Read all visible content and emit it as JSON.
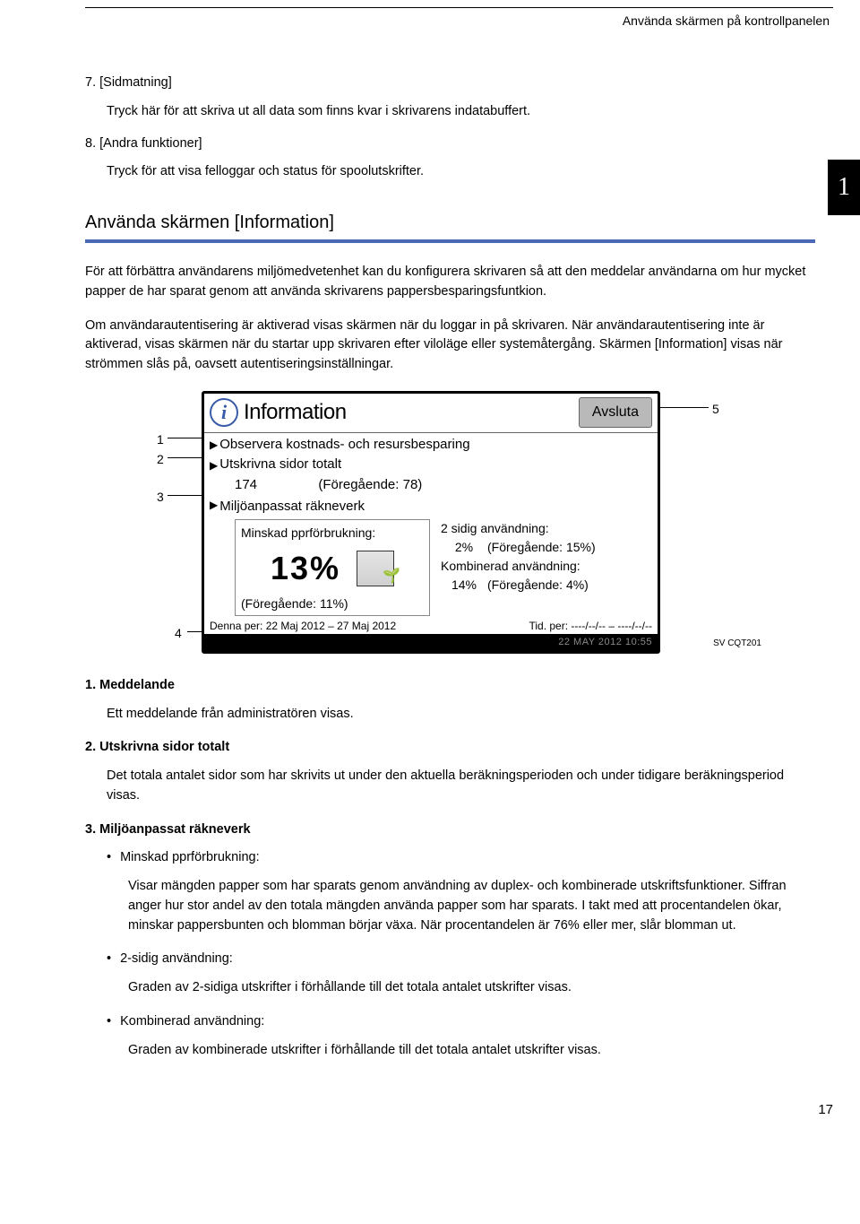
{
  "header": {
    "title": "Använda skärmen på kontrollpanelen"
  },
  "chapter_tab": "1",
  "ol7": {
    "num": "7.",
    "title": "[Sidmatning]",
    "body": "Tryck här för att skriva ut all data som finns kvar i skrivarens indatabuffert."
  },
  "ol8": {
    "num": "8.",
    "title": "[Andra funktioner]",
    "body": "Tryck för att visa felloggar och status för spoolutskrifter."
  },
  "section": {
    "title": "Använda skärmen [Information]",
    "p1": "För att förbättra användarens miljömedvetenhet kan du konfigurera skrivaren så att den meddelar användarna om hur mycket papper de har sparat genom att använda skrivarens pappersbesparingsfuntkion.",
    "p2": "Om användarautentisering är aktiverad visas skärmen när du loggar in på skrivaren. När användarautentisering inte är aktiverad, visas skärmen när du startar upp skrivaren efter viloläge eller systemåtergång. Skärmen [Information] visas när strömmen slås på, oavsett autentiseringsinställningar."
  },
  "callouts": {
    "c1": "1",
    "c2": "2",
    "c3": "3",
    "c4": "4",
    "c5": "5"
  },
  "panel": {
    "title": "Information",
    "exit": "Avsluta",
    "msg": "Observera kostnads- och resursbesparing",
    "total_label": "Utskrivna sidor totalt",
    "total_val": "174",
    "total_prev": "(Föregående: 78)",
    "eco_label": "Miljöanpassat räkneverk",
    "eco_reduce_label": "Minskad pprförbrukning:",
    "eco_reduce_val": "13%",
    "eco_reduce_prev": "(Föregående: 11%)",
    "duplex_label": "2 sidig användning:",
    "duplex_val": "2%",
    "duplex_prev": "(Föregående: 15%)",
    "combine_label": "Kombinerad användning:",
    "combine_val": "14%",
    "combine_prev": "(Föregående: 4%)",
    "period_now": "Denna per: 22 Maj 2012 – 27 Maj 2012",
    "period_prev": "Tid. per:    ----/--/-- – ----/--/--",
    "status": "22 MAY 2012 10:55"
  },
  "img_id": "SV CQT201",
  "defs": {
    "d1": {
      "num": "1.",
      "title": "Meddelande",
      "body": "Ett meddelande från administratören visas."
    },
    "d2": {
      "num": "2.",
      "title": "Utskrivna sidor totalt",
      "body": "Det totala antalet sidor som har skrivits ut under den aktuella beräkningsperioden och under tidigare beräkningsperiod visas."
    },
    "d3": {
      "num": "3.",
      "title": "Miljöanpassat räkneverk"
    },
    "b1": {
      "label": "Minskad pprförbrukning:",
      "body": "Visar mängden papper som har sparats genom användning av duplex- och kombinerade utskriftsfunktioner. Siffran anger hur stor andel av den totala mängden använda papper som har sparats. I takt med att procentandelen ökar, minskar pappersbunten och blomman börjar växa. När procentandelen är 76% eller mer, slår blomman ut."
    },
    "b2": {
      "label": "2-sidig användning:",
      "body": "Graden av 2-sidiga utskrifter i förhållande till det totala antalet utskrifter visas."
    },
    "b3": {
      "label": "Kombinerad användning:",
      "body": "Graden av kombinerade utskrifter i förhållande till det totala antalet utskrifter visas."
    }
  },
  "page_num": "17"
}
